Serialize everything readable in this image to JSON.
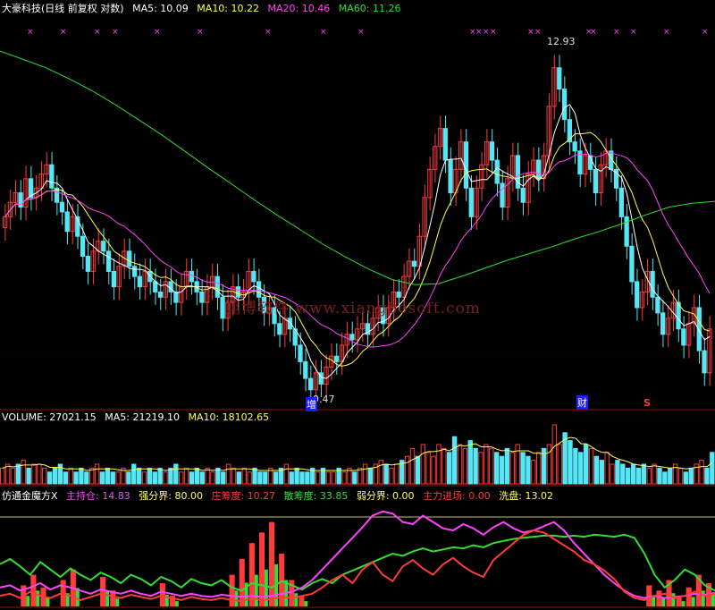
{
  "colors": {
    "up": "#ff3b3b",
    "down": "#55e7f5",
    "ma5": "#ffffff",
    "ma10": "#ffff55",
    "ma20": "#ff44ff",
    "ma60": "#33dd33",
    "axis": "#b00000",
    "grid": "#7a0000"
  },
  "header": {
    "title": "大豪科技(日线 前复权 对数)",
    "ma5": "MA5: 10.09",
    "ma10": "MA10: 10.22",
    "ma20": "MA20: 10.46",
    "ma60": "MA60: 11.26"
  },
  "volume_header": {
    "title": "VOLUME: 27021.15",
    "ma5": "MA5: 21219.10",
    "ma10": "MA10: 18102.65"
  },
  "indicator_header": {
    "title": "仿通金魔方X",
    "zhuchicang": "主持仓: 14.83",
    "qiangfenjie": "强分界: 80.00",
    "zhuangchoudu": "庄筹度: 10.27",
    "sanchoudu": "散筹度: 33.85",
    "ruofenjie": "弱分界: 0.00",
    "zhulijinchang": "主力进场: 0.00",
    "xipan": "洗盘: 13.02"
  },
  "watermark": "翔博软件 www.xiangbosoft.com",
  "annotations": {
    "high": "12.93",
    "low": "9.47",
    "marker_zeng": "增",
    "marker_cai": "财",
    "marker_s": "S"
  },
  "chart_data": [
    {
      "type": "candlestick",
      "title": "大豪科技(日线 前复权 对数)",
      "y_range": [
        9.3,
        13.4
      ],
      "high_label": 12.93,
      "low_label": 9.47,
      "close_path": [
        11.1,
        11.25,
        11.35,
        11.2,
        11.5,
        11.3,
        11.4,
        11.55,
        11.65,
        11.4,
        11.25,
        11.15,
        10.95,
        11.1,
        10.9,
        10.7,
        10.55,
        10.75,
        10.85,
        10.75,
        10.55,
        10.4,
        10.6,
        10.75,
        10.6,
        10.5,
        10.4,
        10.55,
        10.45,
        10.35,
        10.3,
        10.45,
        10.35,
        10.25,
        10.4,
        10.55,
        10.45,
        10.35,
        10.25,
        10.4,
        10.5,
        10.3,
        10.1,
        10.25,
        10.4,
        10.3,
        10.35,
        10.55,
        10.45,
        10.3,
        10.15,
        10.2,
        10.05,
        9.95,
        10.1,
        10.0,
        9.85,
        9.7,
        9.55,
        9.45,
        9.6,
        9.5,
        9.65,
        9.75,
        9.7,
        9.85,
        9.95,
        9.9,
        10.0,
        10.05,
        9.95,
        10.1,
        10.2,
        10.05,
        10.2,
        10.35,
        10.3,
        10.5,
        10.65,
        10.6,
        10.9,
        11.3,
        11.6,
        11.85,
        12.05,
        11.7,
        11.35,
        11.6,
        11.9,
        11.4,
        11.1,
        11.4,
        11.65,
        11.9,
        11.7,
        11.45,
        11.2,
        11.5,
        11.75,
        11.4,
        11.25,
        11.55,
        11.7,
        11.5,
        11.75,
        12.3,
        12.75,
        12.5,
        12.15,
        11.9,
        11.8,
        11.55,
        11.75,
        11.6,
        11.35,
        11.65,
        11.8,
        11.6,
        11.4,
        11.1,
        10.8,
        10.45,
        10.2,
        10.35,
        10.55,
        10.3,
        10.15,
        9.95,
        10.1,
        10.25,
        10.0,
        9.85,
        10.05,
        10.2,
        9.8,
        9.6,
        10.0
      ],
      "ma60_path": [
        12.95,
        12.85,
        12.75,
        12.62,
        12.48,
        12.32,
        12.15,
        11.98,
        11.8,
        11.62,
        11.45,
        11.28,
        11.12,
        10.97,
        10.82,
        10.69,
        10.57,
        10.47,
        10.42,
        10.43,
        10.5,
        10.58,
        10.66,
        10.73,
        10.8,
        10.88,
        10.95,
        11.03,
        11.12,
        11.2,
        11.24,
        11.26
      ],
      "series": [
        {
          "name": "MA5",
          "value": 10.09
        },
        {
          "name": "MA10",
          "value": 10.22
        },
        {
          "name": "MA20",
          "value": 10.46
        },
        {
          "name": "MA60",
          "value": 11.26
        }
      ]
    },
    {
      "type": "bar",
      "title": "VOLUME",
      "series": [
        {
          "name": "VOLUME",
          "value": 27021.15
        },
        {
          "name": "MA5",
          "value": 21219.1
        },
        {
          "name": "MA10",
          "value": 18102.65
        }
      ],
      "values": [
        4,
        5,
        4,
        5,
        6,
        4,
        5,
        5,
        4,
        3,
        4,
        5,
        3,
        4,
        3,
        4,
        3,
        4,
        5,
        3,
        4,
        3,
        3,
        4,
        3,
        5,
        4,
        3,
        4,
        3,
        4,
        3,
        4,
        5,
        3,
        4,
        3,
        4,
        3,
        4,
        3,
        4,
        3,
        5,
        4,
        3,
        4,
        3,
        4,
        3,
        3,
        4,
        3,
        4,
        5,
        3,
        4,
        3,
        3,
        4,
        3,
        4,
        3,
        3,
        4,
        3,
        4,
        3,
        4,
        5,
        4,
        5,
        6,
        5,
        4,
        5,
        6,
        7,
        9,
        7,
        10,
        8,
        7,
        10,
        9,
        8,
        12,
        10,
        9,
        11,
        9,
        8,
        10,
        9,
        8,
        7,
        9,
        8,
        10,
        8,
        7,
        6,
        8,
        9,
        10,
        15,
        10,
        13,
        11,
        9,
        8,
        10,
        9,
        7,
        6,
        8,
        5,
        6,
        5,
        4,
        5,
        4,
        5,
        4,
        5,
        4,
        3,
        4,
        5,
        4,
        3,
        4,
        5,
        6,
        4,
        8
      ]
    },
    {
      "type": "line",
      "title": "仿通金魔方X",
      "series": [
        {
          "name": "主持仓",
          "value": 14.83
        },
        {
          "name": "强分界",
          "value": 80.0
        },
        {
          "name": "庄筹度",
          "value": 10.27
        },
        {
          "name": "散筹度",
          "value": 33.85
        },
        {
          "name": "弱分界",
          "value": 0.0
        },
        {
          "name": "主力进场",
          "value": 0.0
        },
        {
          "name": "洗盘",
          "value": 13.02
        }
      ],
      "y_range": [
        0,
        100
      ],
      "green_path": [
        40,
        45,
        38,
        30,
        42,
        35,
        28,
        36,
        30,
        25,
        32,
        28,
        22,
        30,
        26,
        20,
        28,
        24,
        18,
        26,
        22,
        20,
        25,
        18,
        15,
        22,
        20,
        18,
        24,
        20,
        16,
        22,
        26,
        22,
        30,
        34,
        38,
        42,
        46,
        50,
        48,
        52,
        55,
        52,
        54,
        56,
        55,
        58,
        56,
        60,
        62,
        64,
        65,
        66,
        67,
        67,
        66,
        67,
        66,
        68,
        67,
        66,
        68,
        65,
        50,
        30,
        18,
        25,
        35,
        30,
        20,
        15
      ],
      "magenta_path": [
        18,
        20,
        15,
        18,
        22,
        16,
        20,
        18,
        15,
        12,
        16,
        14,
        12,
        15,
        12,
        10,
        14,
        12,
        10,
        12,
        10,
        9,
        11,
        10,
        9,
        10,
        9,
        10,
        12,
        14,
        18,
        25,
        35,
        45,
        55,
        65,
        75,
        86,
        90,
        88,
        80,
        78,
        86,
        80,
        74,
        72,
        78,
        74,
        68,
        75,
        80,
        74,
        70,
        72,
        76,
        80,
        72,
        60,
        50,
        40,
        30,
        22,
        15,
        10,
        8,
        10,
        8,
        9,
        10,
        12,
        11,
        13
      ],
      "red_path": [
        10,
        12,
        8,
        14,
        10,
        8,
        12,
        10,
        6,
        9,
        12,
        10,
        8,
        11,
        9,
        7,
        10,
        8,
        6,
        9,
        7,
        6,
        8,
        6,
        5,
        8,
        6,
        7,
        9,
        8,
        10,
        12,
        18,
        25,
        30,
        22,
        35,
        42,
        30,
        24,
        38,
        44,
        36,
        30,
        40,
        46,
        38,
        32,
        28,
        44,
        52,
        60,
        68,
        72,
        70,
        64,
        58,
        52,
        44,
        40,
        34,
        26,
        14,
        8,
        6,
        10,
        12,
        8,
        10,
        14,
        10,
        12
      ],
      "bars_path": [
        0,
        0,
        20,
        30,
        18,
        0,
        25,
        35,
        0,
        0,
        28,
        15,
        0,
        0,
        0,
        0,
        22,
        10,
        0,
        0,
        0,
        0,
        0,
        30,
        45,
        60,
        70,
        80,
        50,
        25,
        10,
        0,
        0,
        0,
        0,
        0,
        0,
        0,
        0,
        0,
        0,
        0,
        0,
        0,
        0,
        0,
        0,
        0,
        0,
        0,
        0,
        0,
        0,
        0,
        0,
        0,
        0,
        0,
        0,
        0,
        0,
        0,
        0,
        0,
        0,
        20,
        15,
        25,
        10,
        18,
        30,
        22
      ]
    }
  ]
}
